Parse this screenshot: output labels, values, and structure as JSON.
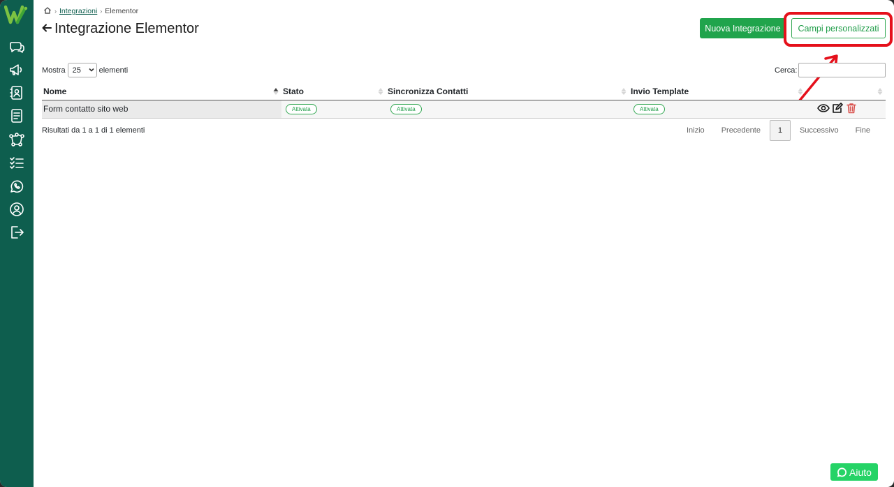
{
  "breadcrumb": {
    "parent": "Integrazioni",
    "current": "Elementor"
  },
  "page": {
    "title": "Integrazione Elementor"
  },
  "toolbar": {
    "new_label": "Nuova Integrazione",
    "custom_fields_label": "Campi personalizzati"
  },
  "table_controls": {
    "show_label": "Mostra",
    "page_size": "25",
    "entries_label": "elementi",
    "search_label": "Cerca:"
  },
  "table": {
    "headers": [
      "Nome",
      "Stato",
      "Sincronizza Contatti",
      "Invio Template"
    ],
    "rows": [
      {
        "name": "Form contatto sito web",
        "status": "Attivata",
        "sync": "Attivata",
        "template": "Attivata"
      }
    ]
  },
  "footer": {
    "info": "Risultati da 1 a 1 di 1 elementi"
  },
  "pagination": {
    "first": "Inizio",
    "prev": "Precedente",
    "current": "1",
    "next": "Successivo",
    "last": "Fine"
  },
  "help": {
    "label": "Aiuto"
  },
  "colors": {
    "sidebar": "#0e5e4e",
    "primary": "#20a44c",
    "accent_outline": "#34a853",
    "highlight": "#e5101b",
    "delete": "#d9534f",
    "whatsapp": "#25d366"
  },
  "icons": {
    "sidebar": [
      "chat-icon",
      "megaphone-icon",
      "contacts-icon",
      "document-icon",
      "flow-icon",
      "checklist-icon",
      "whatsapp-icon",
      "user-icon",
      "logout-icon"
    ],
    "row_actions": [
      "eye-icon",
      "edit-icon",
      "trash-icon"
    ]
  }
}
